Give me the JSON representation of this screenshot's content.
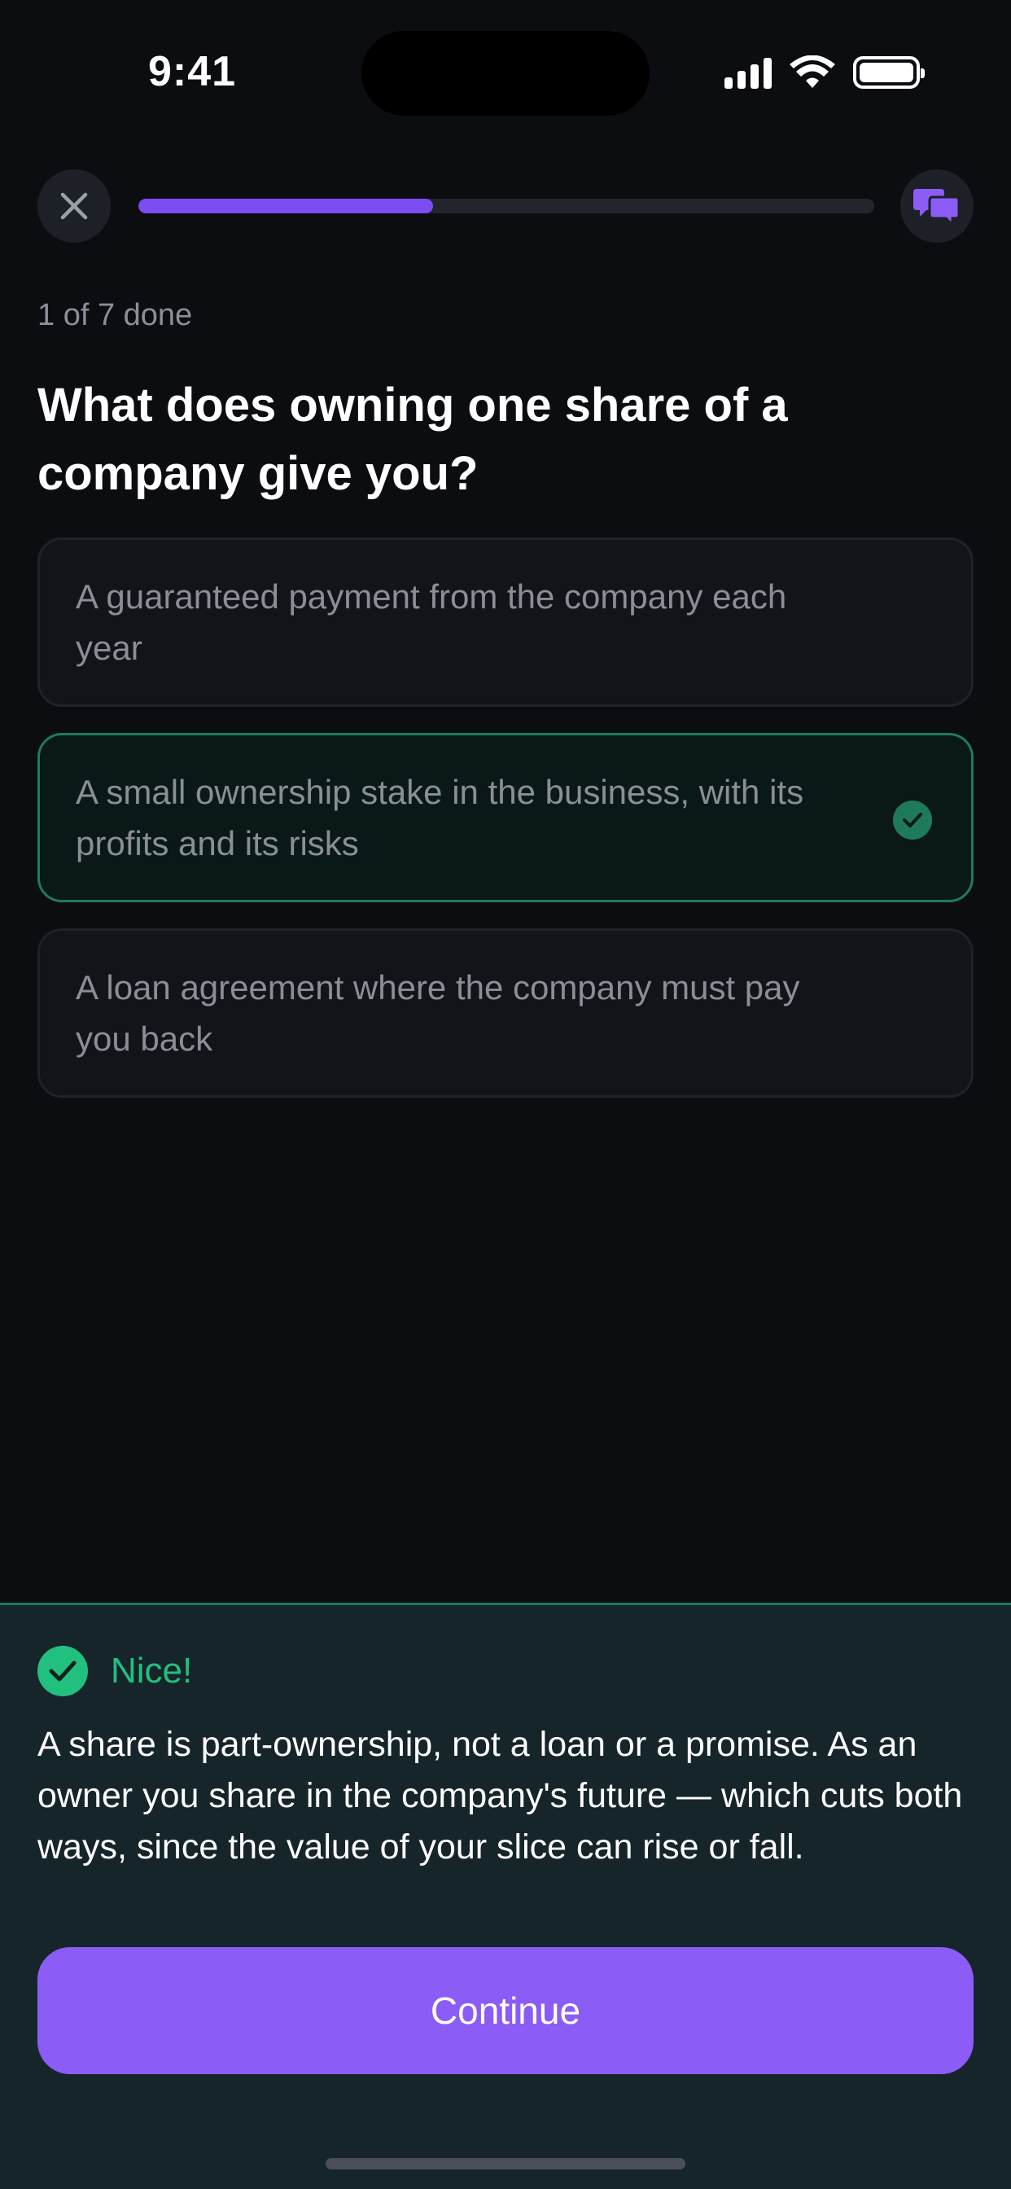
{
  "status_bar": {
    "time": "9:41"
  },
  "top_bar": {
    "close_icon": "close-icon",
    "chat_icon": "chat-bubbles-icon",
    "progress_fraction": 0.4,
    "progress_color": "#7c4df0"
  },
  "quiz": {
    "step_label": "1 of 7 done",
    "question": "What does owning one share of a company give you?",
    "options": [
      {
        "label": "A guaranteed payment from the company each year",
        "state": "default"
      },
      {
        "label": "A small ownership stake in the business, with its profits and its risks",
        "state": "correct"
      },
      {
        "label": "A loan agreement where the company must pay you back",
        "state": "default"
      }
    ]
  },
  "feedback": {
    "title": "Nice!",
    "icon": "check-circle-icon",
    "body": "A share is part-ownership, not a loan or a promise. As an owner you share in the company's future — which cuts both ways, since the value of your slice can rise or fall.",
    "accent_color": "#22c07f"
  },
  "actions": {
    "continue_label": "Continue",
    "button_color": "#8b5cf6"
  }
}
